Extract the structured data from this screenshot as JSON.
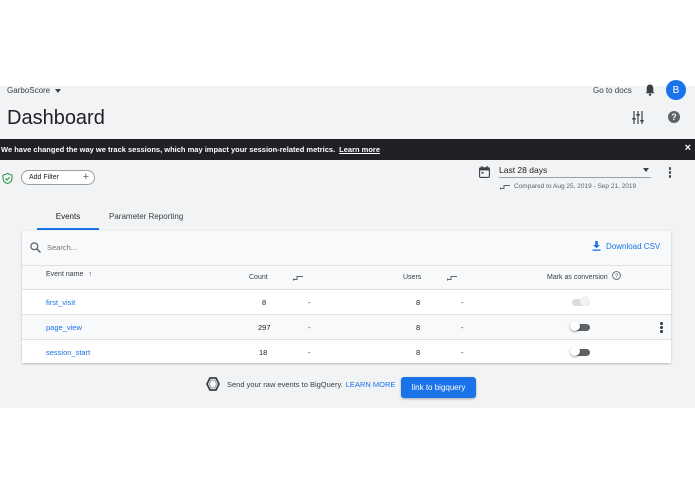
{
  "header": {
    "property_name": "GarboScore",
    "page_title": "Dashboard",
    "docs_link": "Go to docs",
    "avatar_initial": "B",
    "help_icon": "?"
  },
  "banner": {
    "message": "We have changed the way we track sessions, which may impact your session-related metrics.",
    "link": "Learn more",
    "close": "×"
  },
  "filters": {
    "add_filter_label": "Add Filter",
    "add_icon": "+"
  },
  "date": {
    "range_label": "Last 28 days",
    "compare_text": "Compared to Aug 25, 2019 - Sep 21, 2019"
  },
  "tabs": [
    {
      "label": "Events",
      "active": true
    },
    {
      "label": "Parameter Reporting",
      "active": false
    }
  ],
  "table": {
    "search_placeholder": "Search...",
    "download_label": "Download CSV",
    "columns": {
      "event_name": "Event name",
      "count": "Count",
      "users": "Users",
      "conversion": "Mark as conversion"
    },
    "rows": [
      {
        "event": "first_visit",
        "count": "8",
        "count_change": "-",
        "users": "8",
        "users_change": "-",
        "conversion": false,
        "conversion_disabled": true
      },
      {
        "event": "page_view",
        "count": "297",
        "count_change": "-",
        "users": "8",
        "users_change": "-",
        "conversion": false,
        "conversion_disabled": false
      },
      {
        "event": "session_start",
        "count": "18",
        "count_change": "-",
        "users": "8",
        "users_change": "-",
        "conversion": false,
        "conversion_disabled": false
      }
    ]
  },
  "bigquery": {
    "text": "Send your raw events to BigQuery.",
    "learn_more": "LEARN MORE",
    "button_label": "link to bigquery"
  },
  "colors": {
    "accent": "#1a73e8",
    "banner_bg": "#202124",
    "page_bg": "#f1f3f4"
  },
  "icons": [
    "dropdown-caret-icon",
    "bell-icon",
    "sliders-icon",
    "help-icon",
    "close-icon",
    "shield-check-icon",
    "plus-icon",
    "calendar-icon",
    "compare-icon",
    "more-vert-icon",
    "search-icon",
    "download-icon",
    "sort-arrow-up-icon",
    "info-icon",
    "bigquery-icon"
  ]
}
